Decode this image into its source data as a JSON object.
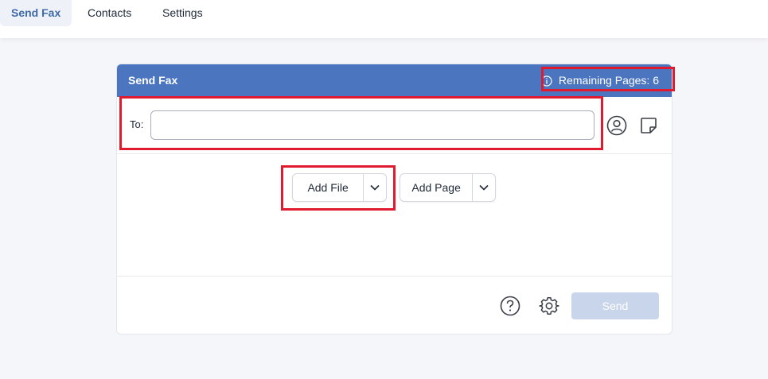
{
  "nav": {
    "tabs": [
      {
        "label": "Send Fax"
      },
      {
        "label": "Contacts"
      },
      {
        "label": "Settings"
      }
    ]
  },
  "panel": {
    "title": "Send Fax",
    "remaining_pages": "Remaining Pages: 6"
  },
  "to": {
    "label": "To:",
    "value": "",
    "placeholder": ""
  },
  "actions": {
    "add_file": "Add File",
    "add_page": "Add Page"
  },
  "footer": {
    "send_label": "Send"
  },
  "colors": {
    "header": "#4b76bf",
    "active_tab_text": "#3f6aa8",
    "send_disabled": "#c9d5ea",
    "highlight": "#e01b2f"
  },
  "icons": [
    "info-icon",
    "contact-book-icon",
    "note-icon",
    "chevron-down-icon",
    "help-icon",
    "gear-icon"
  ]
}
